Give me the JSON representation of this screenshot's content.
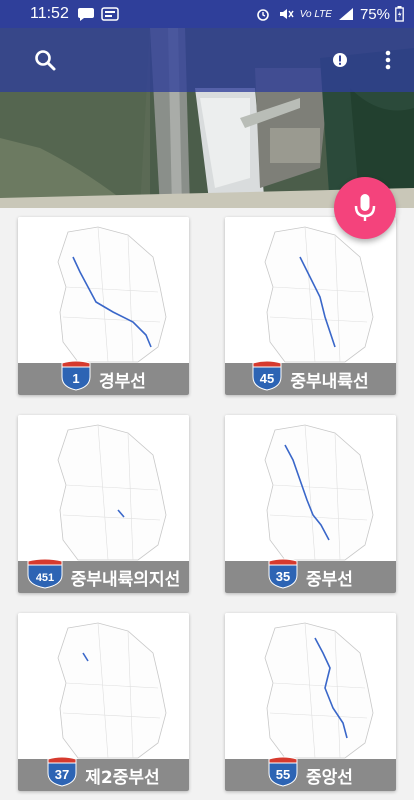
{
  "status_bar": {
    "time": "11:52",
    "battery": "75%",
    "network": "Vo LTE"
  },
  "toolbar": {
    "search_icon": "search-icon",
    "info_icon": "alert-circle-icon",
    "more_icon": "more-vert-icon"
  },
  "fab": {
    "icon": "mic-icon",
    "color": "#f4437c"
  },
  "colors": {
    "header": "#2f3f9a",
    "shield_red": "#d63a2e",
    "shield_blue": "#2d64b4",
    "label_bar": "#8a8a8a"
  },
  "routes": [
    {
      "number": "1",
      "name": "경부선"
    },
    {
      "number": "45",
      "name": "중부내륙선"
    },
    {
      "number": "451",
      "name": "중부내륙의지선"
    },
    {
      "number": "35",
      "name": "중부선"
    },
    {
      "number": "37",
      "name": "제2중부선"
    },
    {
      "number": "55",
      "name": "중앙선"
    }
  ]
}
